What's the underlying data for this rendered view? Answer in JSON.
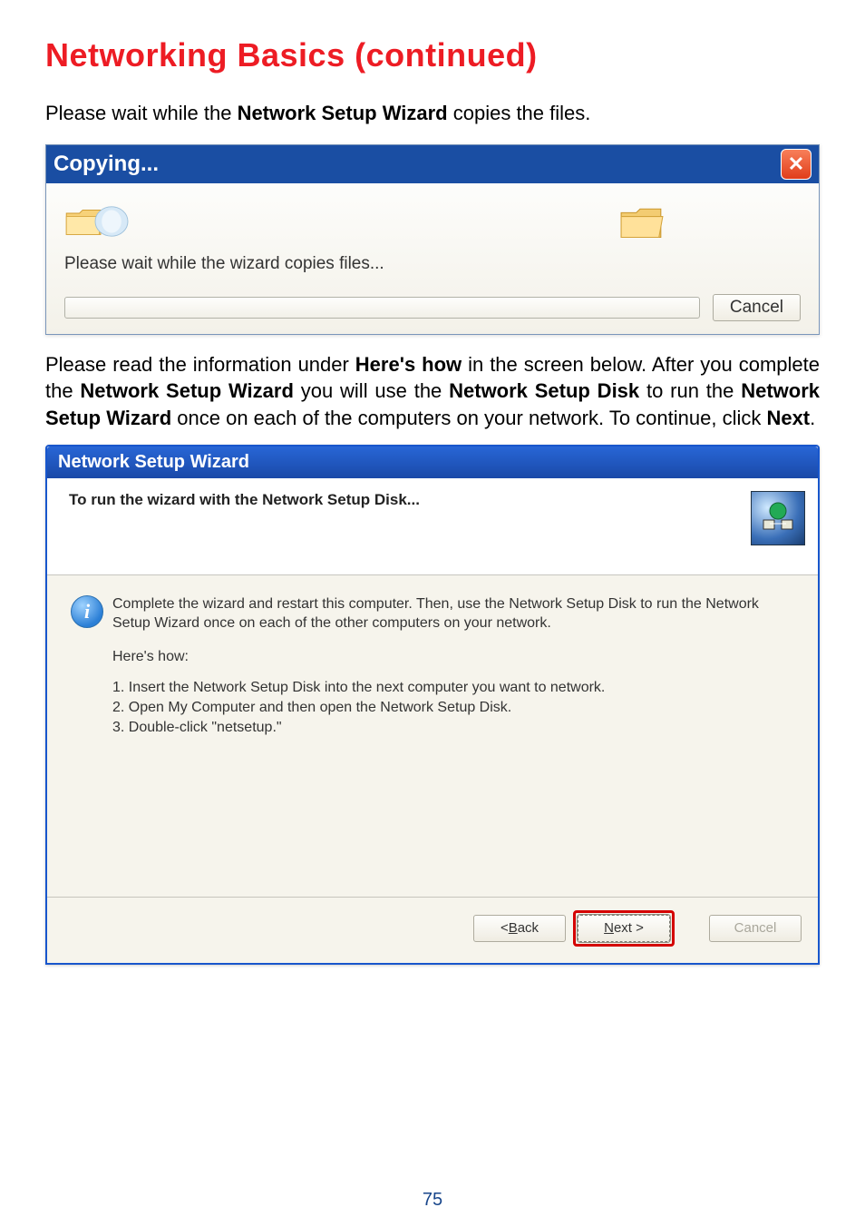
{
  "page": {
    "title": "Networking Basics (continued)",
    "intro_prefix": "Please wait while the ",
    "intro_bold": "Network Setup Wizard",
    "intro_suffix": " copies the files.",
    "page_number": "75"
  },
  "copying": {
    "title": "Copying...",
    "body_text": "Please wait while the wizard copies files...",
    "cancel": "Cancel"
  },
  "para2": {
    "seg1": "Please read the information under ",
    "b1": "Here's how",
    "seg2": " in the screen below.  After you complete the ",
    "b2": "Network Setup Wizard",
    "seg3": " you will use the ",
    "b3": "Network Setup Disk",
    "seg4": " to run the ",
    "b4": "Network Setup Wizard",
    "seg5": " once on each of the computers on your network.  To continue, click ",
    "b5": "Next",
    "seg6": "."
  },
  "wizard": {
    "title": "Network Setup Wizard",
    "header_text": "To run the wizard with the Network Setup Disk...",
    "info_text": "Complete the wizard and restart this computer. Then, use the Network Setup Disk to run the Network Setup Wizard once on each of the other computers on your network.",
    "heres_how": "Here's how:",
    "step1": "1.  Insert the Network Setup Disk into the next computer you want to network.",
    "step2": "2.  Open My Computer and then open the Network Setup Disk.",
    "step3": "3.  Double-click \"netsetup.\"",
    "back_prefix": "< ",
    "back_letter": "B",
    "back_rest": "ack",
    "next_letter": "N",
    "next_rest": "ext >",
    "cancel": "Cancel"
  }
}
